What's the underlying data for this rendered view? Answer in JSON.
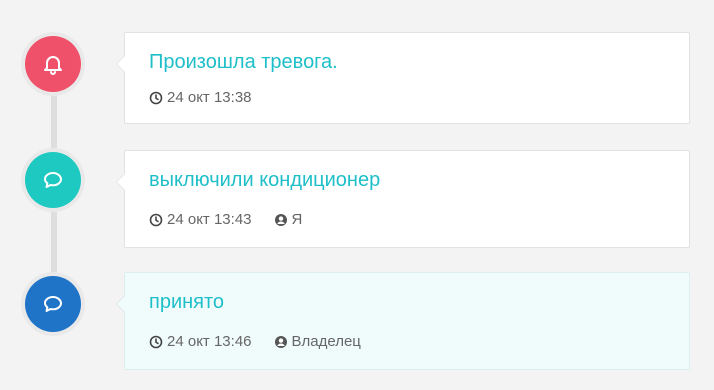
{
  "events": [
    {
      "title": "Произошла тревога.",
      "time": "24 окт 13:38",
      "author": "",
      "icon": "bell-icon",
      "color": "#f0516a"
    },
    {
      "title": "выключили кондиционер",
      "time": "24 окт 13:43",
      "author": "Я",
      "icon": "comment-icon",
      "color": "#1ec9c1"
    },
    {
      "title": "принято",
      "time": "24 окт 13:46",
      "author": "Владелец",
      "icon": "comment-icon",
      "color": "#1f74c8"
    }
  ]
}
